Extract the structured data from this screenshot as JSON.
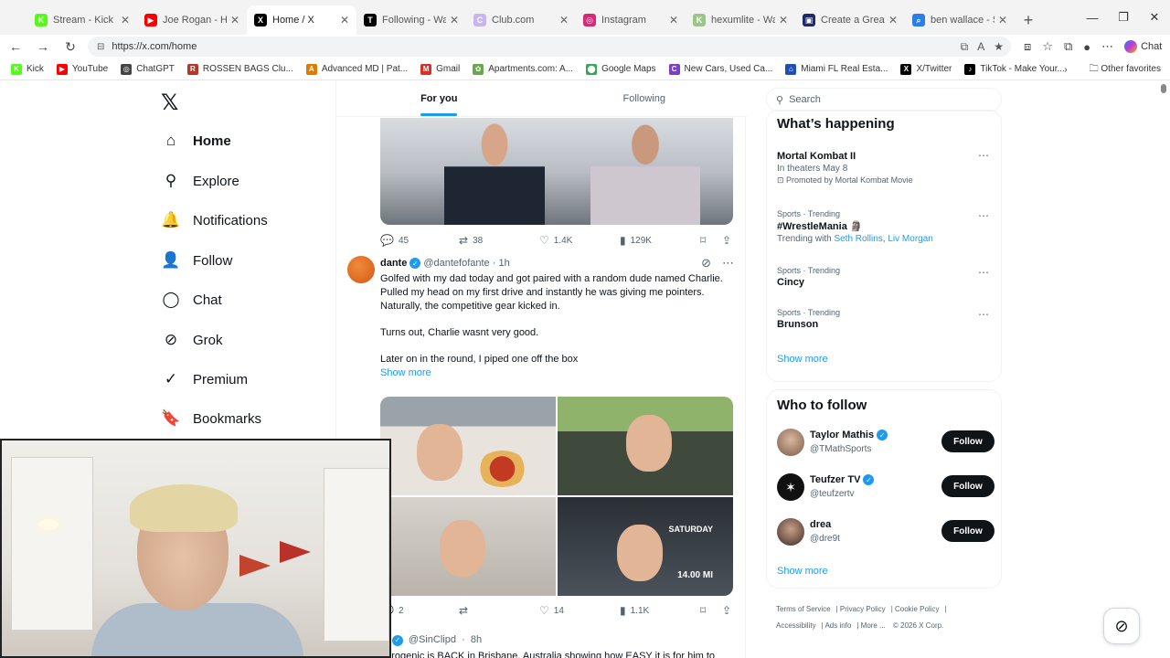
{
  "browser": {
    "tabs": [
      {
        "title": "Stream - Kick Dashb",
        "icon_color": "#53fc18",
        "icon_text": "K",
        "active": false
      },
      {
        "title": "Joe Rogan - He Live",
        "icon_color": "#ff0000",
        "icon_text": "▶",
        "active": false
      },
      {
        "title": "Home / X",
        "icon_color": "#000000",
        "icon_text": "X",
        "active": true
      },
      {
        "title": "Following - Watch v",
        "icon_color": "#000000",
        "icon_text": "T",
        "active": false
      },
      {
        "title": "Club.com",
        "icon_color": "#c9b6f0",
        "icon_text": "C",
        "active": false
      },
      {
        "title": "Instagram",
        "icon_color": "#d62976",
        "icon_text": "◎",
        "active": false
      },
      {
        "title": "hexumlite - Watch L",
        "icon_color": "#9cc58a",
        "icon_text": "K",
        "active": false
      },
      {
        "title": "Create a Greatest A",
        "icon_color": "#1f2a6b",
        "icon_text": "▣",
        "active": false
      },
      {
        "title": "ben wallace - Searc",
        "icon_color": "#2b7de9",
        "icon_text": "⌕",
        "active": false
      }
    ],
    "url": "https://x.com/home",
    "chat_label": "Chat",
    "bookmarks": [
      {
        "label": "Kick",
        "color": "#53fc18",
        "icon": "K"
      },
      {
        "label": "YouTube",
        "color": "#ff0000",
        "icon": "▶"
      },
      {
        "label": "ChatGPT",
        "color": "#444444",
        "icon": "◎"
      },
      {
        "label": "ROSSEN BAGS Clu...",
        "color": "#b5352b",
        "icon": "R"
      },
      {
        "label": "Advanced MD | Pat...",
        "color": "#e07b00",
        "icon": "A"
      },
      {
        "label": "Gmail",
        "color": "#d93025",
        "icon": "M"
      },
      {
        "label": "Apartments.com: A...",
        "color": "#6aa84f",
        "icon": "✿"
      },
      {
        "label": "Google Maps",
        "color": "#34a853",
        "icon": "⬤"
      },
      {
        "label": "New Cars, Used Ca...",
        "color": "#7b3fc4",
        "icon": "C"
      },
      {
        "label": "Miami FL Real Esta...",
        "color": "#1f4fb3",
        "icon": "⌂"
      },
      {
        "label": "X/Twitter",
        "color": "#000000",
        "icon": "X"
      },
      {
        "label": "TikTok - Make Your...",
        "color": "#000000",
        "icon": "♪"
      }
    ],
    "other_favorites": "Other favorites"
  },
  "nav": {
    "items": [
      {
        "label": "Home",
        "icon": "⌂",
        "name": "home"
      },
      {
        "label": "Explore",
        "icon": "⚲",
        "name": "explore"
      },
      {
        "label": "Notifications",
        "icon": "🔔",
        "name": "notifications"
      },
      {
        "label": "Follow",
        "icon": "👤",
        "name": "follow"
      },
      {
        "label": "Chat",
        "icon": "◯",
        "name": "chat"
      },
      {
        "label": "Grok",
        "icon": "⊘",
        "name": "grok"
      },
      {
        "label": "Premium",
        "icon": "✓",
        "name": "premium"
      },
      {
        "label": "Bookmarks",
        "icon": "🔖",
        "name": "bookmarks"
      }
    ]
  },
  "feed": {
    "tabs": [
      "For you",
      "Following"
    ],
    "tweet1_actions": {
      "replies": "45",
      "reposts": "38",
      "likes": "1.4K",
      "views": "129K"
    },
    "tweet2": {
      "name": "dante",
      "handle": "@dantefofante",
      "time": "1h",
      "lines": [
        "Golfed with my dad today and got paired with a random dude named Charlie. Pulled my head on my first drive and instantly he was giving me pointers. Naturally, the competitive gear kicked in.",
        "Turns out, Charlie wasnt very good.",
        "Later on in the round, I piped one off the box"
      ],
      "show_more": "Show more",
      "image_caption_1": "SATURDAY",
      "image_caption_2": "14.00 MI",
      "actions": {
        "replies": "2",
        "reposts": "",
        "likes": "14",
        "views": "1.1K"
      }
    },
    "tweet3": {
      "name": "n",
      "handle": "@SinClipd",
      "time": "8h",
      "text": "ndrogenic is BACK in Brisbane. Australia showing how EASY it is for him to"
    }
  },
  "right": {
    "search_placeholder": "Search",
    "whats_happening": "What’s happening",
    "trends": [
      {
        "cat": "",
        "title": "Mortal Kombat II",
        "sub": "In theaters May 8",
        "promo": "Promoted by Mortal Kombat Movie"
      },
      {
        "cat": "Sports · Trending",
        "title": "#WrestleMania 🗿",
        "sub_prefix": "Trending with ",
        "link1": "Seth Rollins",
        "link2": "Liv Morgan"
      },
      {
        "cat": "Sports · Trending",
        "title": "Cincy"
      },
      {
        "cat": "Sports · Trending",
        "title": "Brunson"
      }
    ],
    "show_more": "Show more",
    "who_to_follow": "Who to follow",
    "follow_suggestions": [
      {
        "name": "Taylor Mathis",
        "handle": "@TMathSports",
        "verified": true,
        "button": "Follow"
      },
      {
        "name": "Teufzer TV",
        "handle": "@teufzertv",
        "verified": true,
        "button": "Follow"
      },
      {
        "name": "drea",
        "handle": "@dre9t",
        "verified": false,
        "button": "Follow"
      }
    ],
    "footer": [
      "Terms of Service",
      "Privacy Policy",
      "Cookie Policy",
      "Accessibility",
      "Ads info",
      "More ...",
      "© 2026 X Corp."
    ]
  }
}
